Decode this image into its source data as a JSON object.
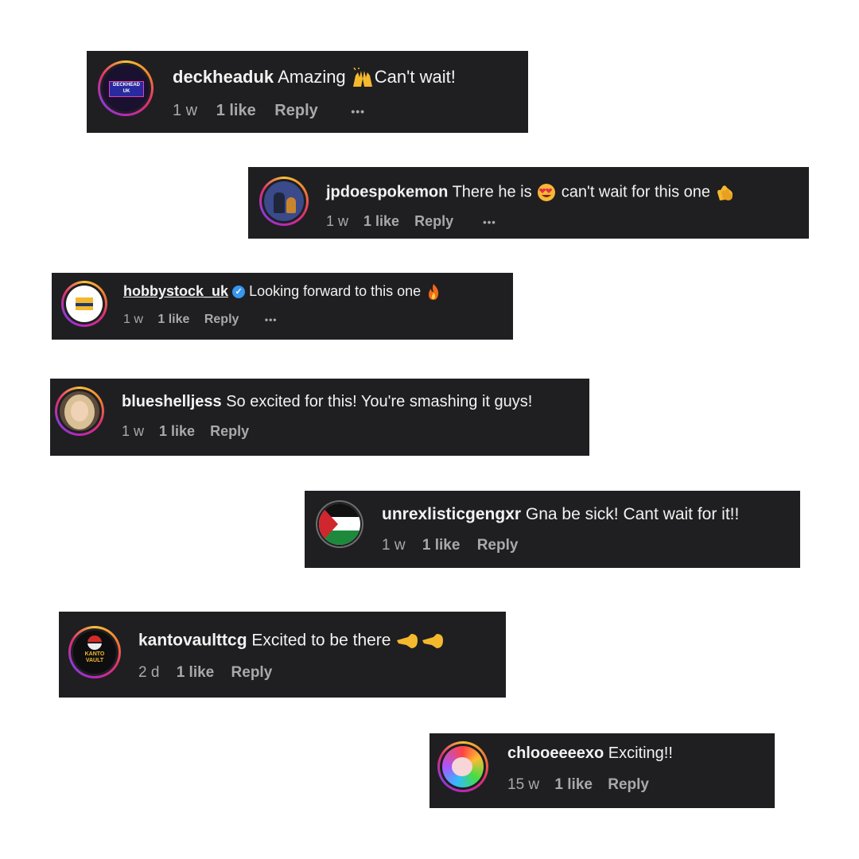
{
  "comments": [
    {
      "username": "deckheaduk",
      "text": "Amazing",
      "text_after": "Can't wait!",
      "time": "1 w",
      "likes": "1 like",
      "reply": "Reply",
      "more": "•••",
      "emoji": "raising-hands"
    },
    {
      "username": "jpdoespokemon",
      "text": "There he is",
      "text_mid": "can't wait for this one",
      "time": "1 w",
      "likes": "1 like",
      "reply": "Reply",
      "more": "•••",
      "emoji": "heart-eyes",
      "emoji2": "clapping-hands"
    },
    {
      "username": "hobbystock_uk",
      "text": "Looking forward to this one",
      "time": "1 w",
      "likes": "1 like",
      "reply": "Reply",
      "more": "•••",
      "emoji": "fire",
      "verified": "✓"
    },
    {
      "username": "blueshelljess",
      "text": "So excited for this! You're smashing it guys!",
      "time": "1 w",
      "likes": "1 like",
      "reply": "Reply"
    },
    {
      "username": "unrexlisticgengxr",
      "text": "Gna be sick! Cant wait for it!!",
      "time": "1 w",
      "likes": "1 like",
      "reply": "Reply"
    },
    {
      "username": "kantovaulttcg",
      "text": "Excited to be there",
      "time": "2 d",
      "likes": "1 like",
      "reply": "Reply",
      "emoji": "pointing-hands"
    },
    {
      "username": "chlooeeeexo",
      "text": "Exciting!!",
      "time": "15 w",
      "likes": "1 like",
      "reply": "Reply"
    }
  ],
  "avatars": {
    "deckheaduk": "DECKHEAD UK",
    "kantovault": "KANTO VAULT"
  },
  "colors": {
    "card_bg": "#1f1f21",
    "text_primary": "#f2f2f2",
    "text_secondary": "#a9a9ad",
    "verified": "#3897f0"
  }
}
